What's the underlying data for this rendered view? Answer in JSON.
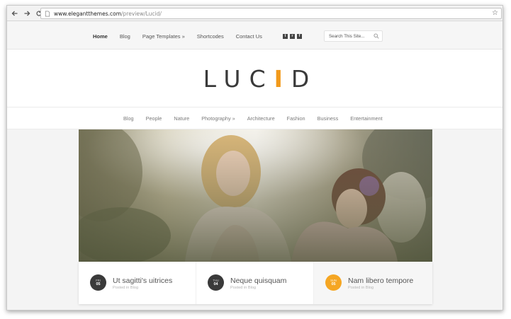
{
  "browser": {
    "url_host": "www.elegantthemes.com",
    "url_path": "/preview/Lucid/"
  },
  "topnav": {
    "items": [
      "Home",
      "Blog",
      "Page Templates »",
      "Shortcodes",
      "Contact Us"
    ],
    "social": [
      "t",
      "r",
      "f"
    ],
    "search_placeholder": "Search This Site..."
  },
  "logo": {
    "before": "LUC",
    "accent": "I",
    "after": "D"
  },
  "catnav": {
    "items": [
      "Blog",
      "People",
      "Nature",
      "Photography »",
      "Architecture",
      "Fashion",
      "Business",
      "Entertainment"
    ]
  },
  "features": [
    {
      "dow": "FRI",
      "day": "05",
      "title": "Ut sagitti's uitrices",
      "meta": "Posted in Blog"
    },
    {
      "dow": "THU",
      "day": "04",
      "title": "Neque quisquam",
      "meta": "Posted in Blog"
    },
    {
      "dow": "SUN",
      "day": "05",
      "title": "Nam libero tempore",
      "meta": "Posted in Blog"
    }
  ],
  "colors": {
    "accent": "#f29a1b",
    "dark_badge": "#3a3a3a"
  }
}
